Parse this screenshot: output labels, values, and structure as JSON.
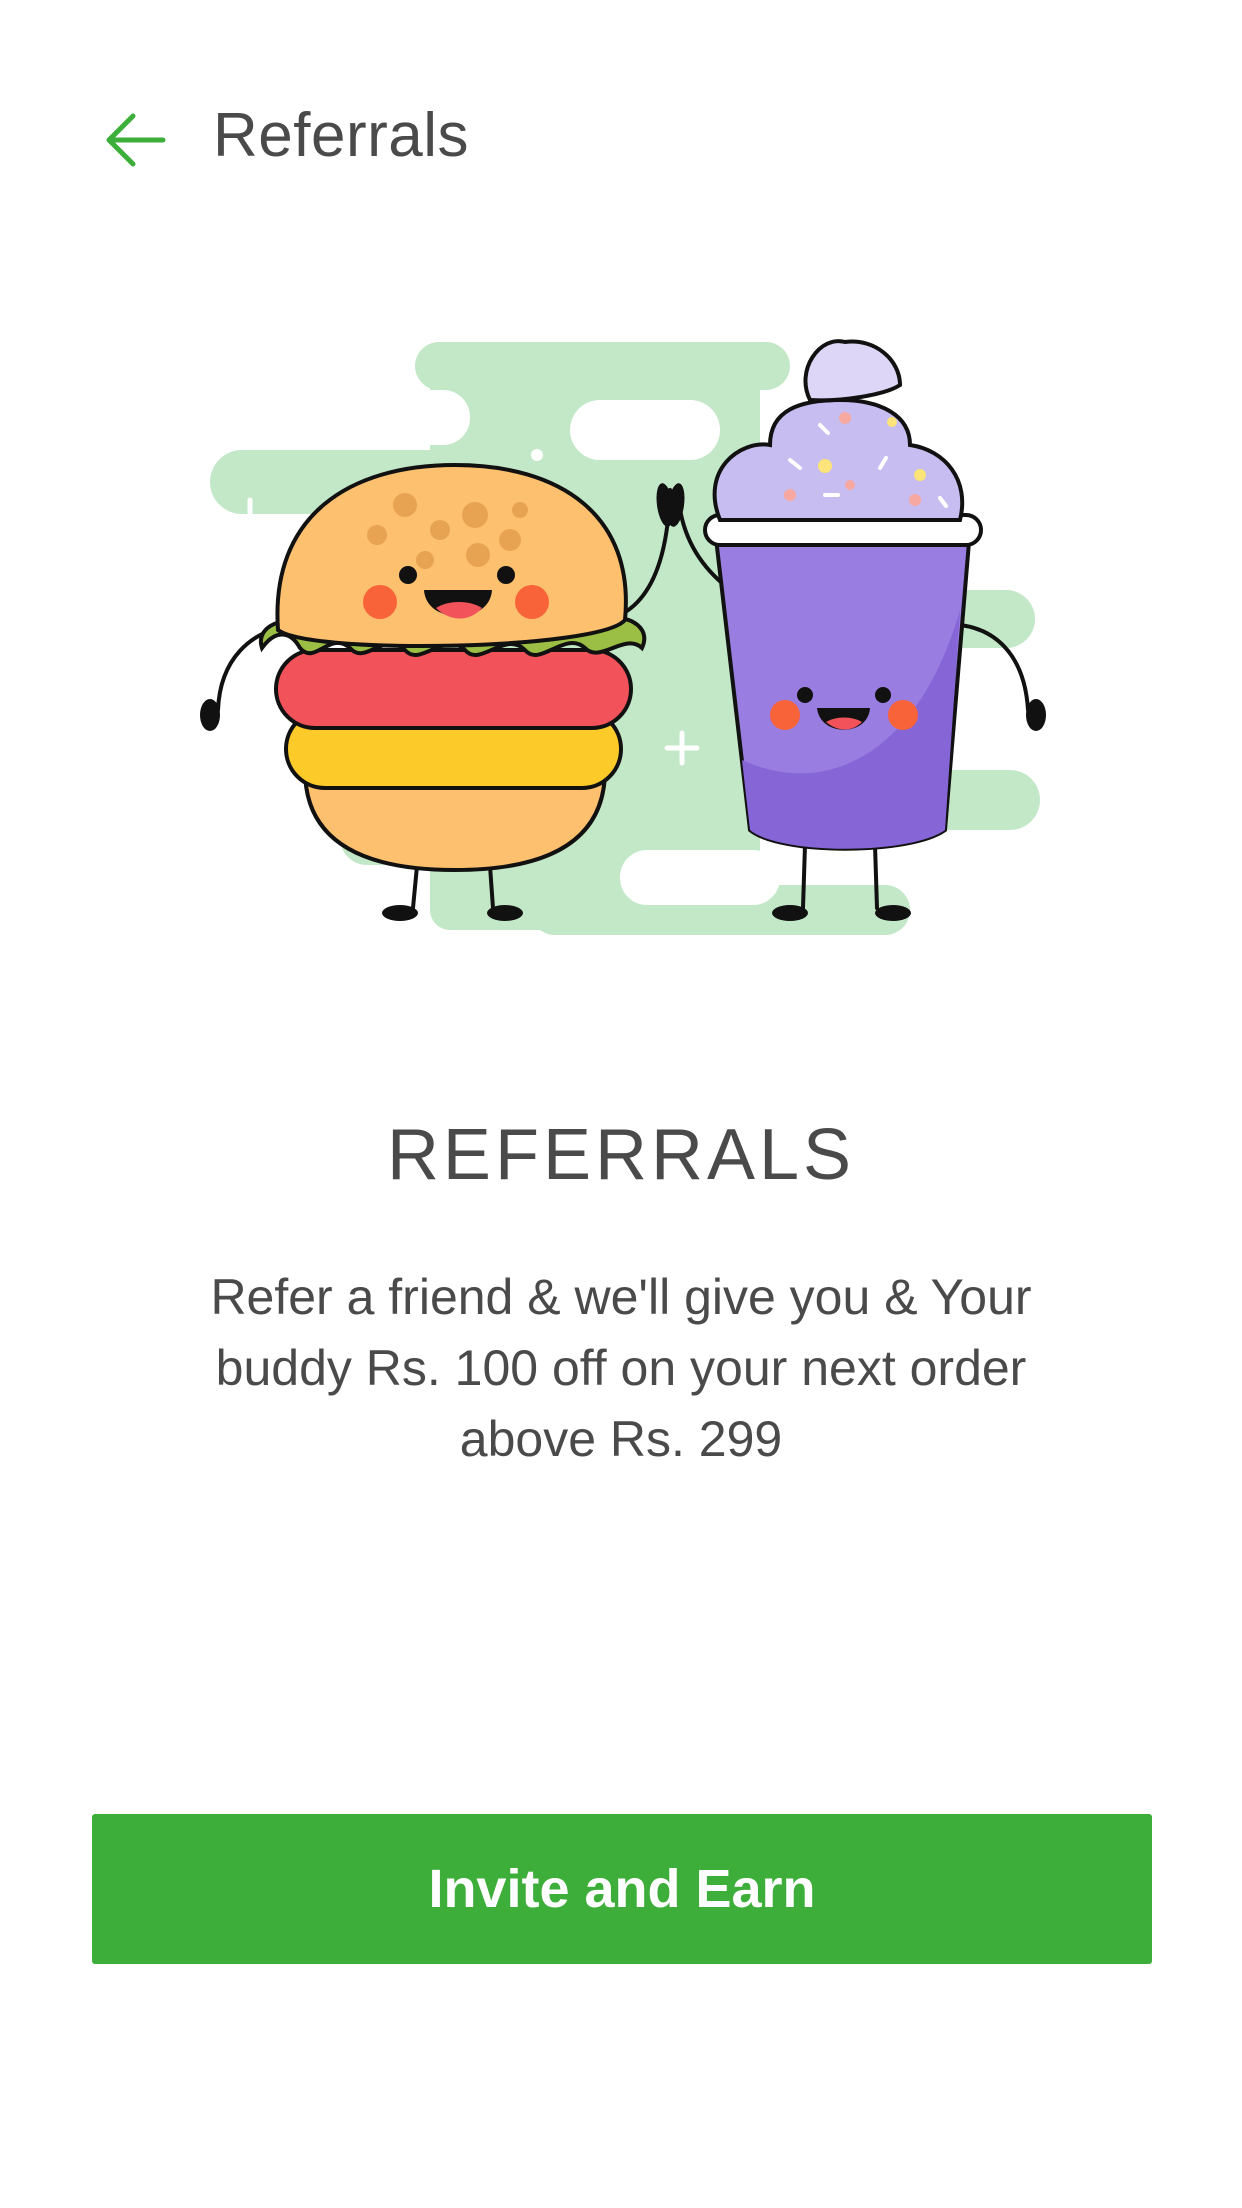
{
  "header": {
    "back_icon": "arrow-left-icon",
    "title": "Referrals"
  },
  "colors": {
    "accent": "#3dae3a",
    "text": "#4a4a4a",
    "illustration_bg": "#c3e8c8",
    "burger_bun": "#fcc06e",
    "lettuce": "#9bbf45",
    "tomato": "#f2525a",
    "cheese": "#fccb2a",
    "cup": "#9a7de0",
    "cream": "#c7bdf0"
  },
  "illustration": {
    "name": "burger-and-shake-high-five"
  },
  "content": {
    "title": "REFERRALS",
    "description": "Refer a friend & we'll give you & Your buddy Rs. 100 off on your next order above Rs. 299"
  },
  "cta": {
    "label": "Invite and Earn"
  }
}
